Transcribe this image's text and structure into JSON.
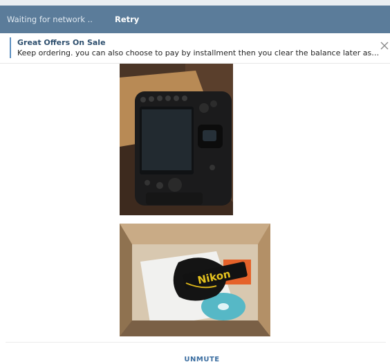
{
  "network_bar": {
    "status_text": "Waiting for network ..",
    "retry_label": "Retry"
  },
  "pinned_message": {
    "title": "Great Offers On Sale",
    "text": "Keep ordering. you can also choose to pay by installment then you clear the balance later as a you have the money",
    "close_icon": "close-icon"
  },
  "media": [
    {
      "kind": "photo",
      "subject": "camera back view"
    },
    {
      "kind": "photo",
      "subject": "camera strap in box",
      "strap_text": "Nikon"
    }
  ],
  "footer": {
    "unmute_label": "UNMUTE"
  },
  "colors": {
    "header_bg": "#5b7c9a",
    "accent": "#5b8fc0",
    "link": "#3a6da0"
  }
}
